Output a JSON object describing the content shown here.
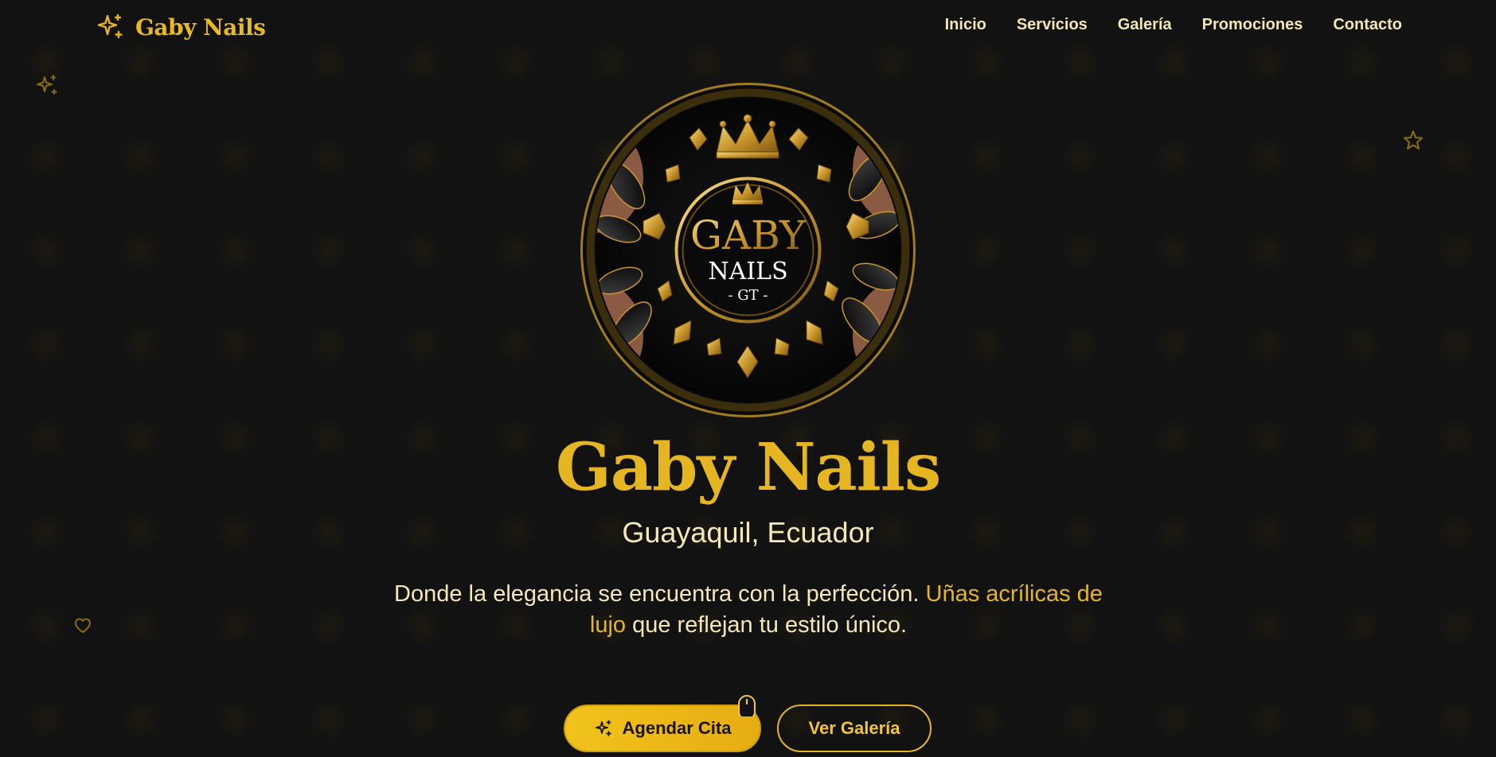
{
  "header": {
    "brand_name": "Gaby Nails",
    "brand_icon": "sparkles-icon",
    "nav": [
      {
        "label": "Inicio"
      },
      {
        "label": "Servicios"
      },
      {
        "label": "Galería"
      },
      {
        "label": "Promociones"
      },
      {
        "label": "Contacto"
      }
    ]
  },
  "logo": {
    "line1": "GABY",
    "line2": "NAILS",
    "line3": "- GT -"
  },
  "hero": {
    "title": "Gaby Nails",
    "location": "Guayaquil, Ecuador",
    "desc_part1": "Donde la elegancia se encuentra con la perfección. ",
    "desc_highlight": "Uñas acrílicas de lujo",
    "desc_part2": " que reflejan tu estilo único.",
    "primary_button": "Agendar Cita",
    "secondary_button": "Ver Galería"
  },
  "colors": {
    "background": "#121212",
    "gold": "#e6b622",
    "cream": "#f4e7b8"
  },
  "decorations": [
    "sparkles-icon",
    "star-icon",
    "heart-icon",
    "mouse-scroll-icon"
  ]
}
